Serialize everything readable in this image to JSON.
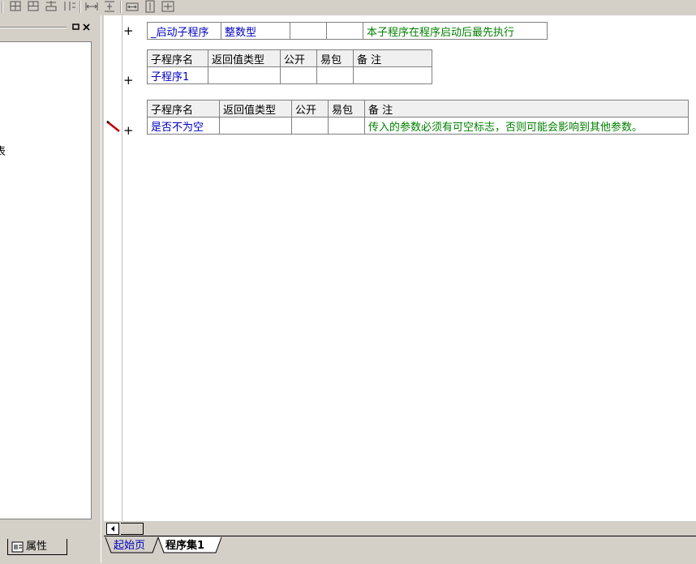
{
  "colors": {
    "accent_blue": "#0000c0",
    "comment_green": "#008000",
    "pencil_red": "#c00000"
  },
  "toolbar": {
    "icons": [
      "grid-insert-icon",
      "grid-delete-icon",
      "grid-merge-icon",
      "grid-split-icon",
      "distribute-horizontal-icon",
      "distribute-vertical-icon",
      "same-width-icon",
      "same-height-icon",
      "same-size-icon"
    ]
  },
  "left_panel": {
    "edge_text": "表",
    "tab_label": "属性"
  },
  "editor": {
    "table1": {
      "name": "_启动子程序",
      "return_type": "整数型",
      "public": "",
      "easy_pack": "",
      "remark": "本子程序在程序启动后最先执行"
    },
    "table2": {
      "headers": [
        "子程序名",
        "返回值类型",
        "公开",
        "易包",
        "备 注"
      ],
      "row": {
        "name": "子程序1",
        "return_type": "",
        "public": "",
        "easy_pack": "",
        "remark": ""
      }
    },
    "table3": {
      "headers": [
        "子程序名",
        "返回值类型",
        "公开",
        "易包",
        "备 注"
      ],
      "row": {
        "name": "是否不为空",
        "return_type": "",
        "public": "",
        "easy_pack": "",
        "remark": "传入的参数必须有可空标志，否则可能会影响到其他参数。"
      }
    },
    "plus_symbol": "+"
  },
  "bottom_tabs": {
    "start_page": "起始页",
    "program_set": "程序集1"
  }
}
